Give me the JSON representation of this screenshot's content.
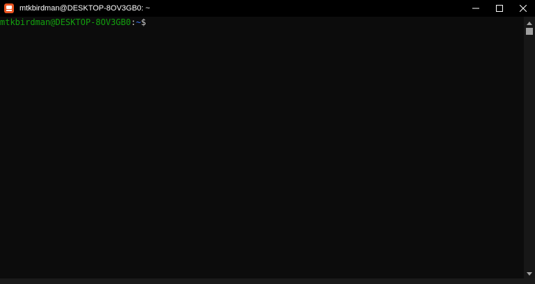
{
  "window": {
    "title": "mtkbirdman@DESKTOP-8OV3GB0: ~"
  },
  "terminal": {
    "prompt_user_host": "mtkbirdman@DESKTOP-8OV3GB0",
    "prompt_separator": ":",
    "prompt_path": "~",
    "prompt_symbol": "$"
  },
  "colors": {
    "prompt_user": "#13a10e",
    "prompt_path": "#3b78ff",
    "background": "#0c0c0c",
    "app_icon": "#e95420"
  },
  "icons": {
    "app": "ubuntu-terminal-icon",
    "minimize": "minimize-icon",
    "maximize": "maximize-icon",
    "close": "close-icon"
  }
}
